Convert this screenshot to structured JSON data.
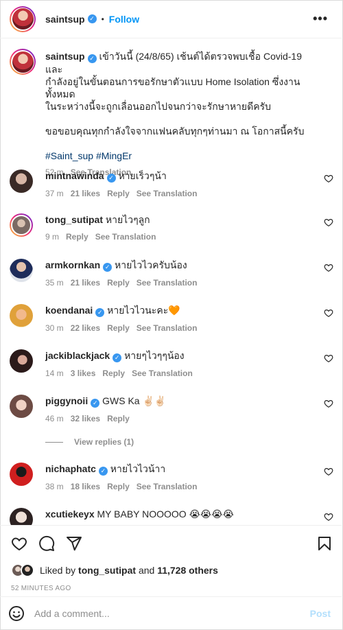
{
  "header": {
    "username": "saintsup",
    "follow_label": "Follow",
    "separator": "•",
    "more_label": "•••"
  },
  "caption": {
    "username": "saintsup",
    "text_line1": "เข้าวันนี้ (24/8/65) เช้นต์ได้ตรวจพบเชื้อ Covid-19 และ",
    "text_line2": "กำลังอยู่ในขั้นตอนการขอรักษาตัวแบบ Home Isolation ซึ่งงานทั้งหมด",
    "text_line3": "ในระหว่างนี้จะถูกเลื่อนออกไปจนกว่าจะรักษาหายดีครับ",
    "text_line4": "ขอขอบคุณทุกกำลังใจจากแฟนคลับทุกๆท่านมา ณ โอกาสนี้ครับ",
    "hashtags": "#Saint_sup #MingEr",
    "time": "52 m",
    "see_translation": "See Translation"
  },
  "comments": [
    {
      "username": "mintnawinda",
      "verified": true,
      "text": "หายเร็วๆน้า",
      "time": "37 m",
      "likes": "21 likes",
      "reply": "Reply",
      "translation": "See Translation"
    },
    {
      "username": "tong_sutipat",
      "verified": false,
      "text": "หายไวๆลูก",
      "time": "9 m",
      "likes": "",
      "reply": "Reply",
      "translation": "See Translation"
    },
    {
      "username": "armkornkan",
      "verified": true,
      "text": "หายไวไวครับน้อง",
      "time": "35 m",
      "likes": "21 likes",
      "reply": "Reply",
      "translation": "See Translation"
    },
    {
      "username": "koendanai",
      "verified": true,
      "text": "หายไวไวนะคะ🧡",
      "time": "30 m",
      "likes": "22 likes",
      "reply": "Reply",
      "translation": "See Translation"
    },
    {
      "username": "jackiblackjack",
      "verified": true,
      "text": "หายๆไวๆๆน้อง",
      "time": "14 m",
      "likes": "3 likes",
      "reply": "Reply",
      "translation": "See Translation"
    },
    {
      "username": "piggynoii",
      "verified": true,
      "text": "GWS Ka ✌🏻✌🏻",
      "time": "46 m",
      "likes": "32 likes",
      "reply": "Reply",
      "translation": ""
    },
    {
      "username": "nichaphatc",
      "verified": true,
      "text": "หายไวไวน้าา",
      "time": "38 m",
      "likes": "18 likes",
      "reply": "Reply",
      "translation": "See Translation"
    },
    {
      "username": "xcutiekeyx",
      "verified": false,
      "text": "MY BABY NOOOOO 😭😭😭😭",
      "time": "",
      "likes": "",
      "reply": "",
      "translation": ""
    }
  ],
  "view_replies": "View replies (1)",
  "likes_summary": {
    "prefix": "Liked by",
    "user": "tong_sutipat",
    "joiner": "and",
    "others": "11,728 others"
  },
  "timestamp": "52 MINUTES AGO",
  "comment_input": {
    "placeholder": "Add a comment...",
    "post_label": "Post"
  },
  "colors": {
    "accent": "#0095f6",
    "verified": "#3897f0",
    "hashtag": "#00376b",
    "muted": "#8e8e8e",
    "post_disabled": "#b2dffc"
  }
}
